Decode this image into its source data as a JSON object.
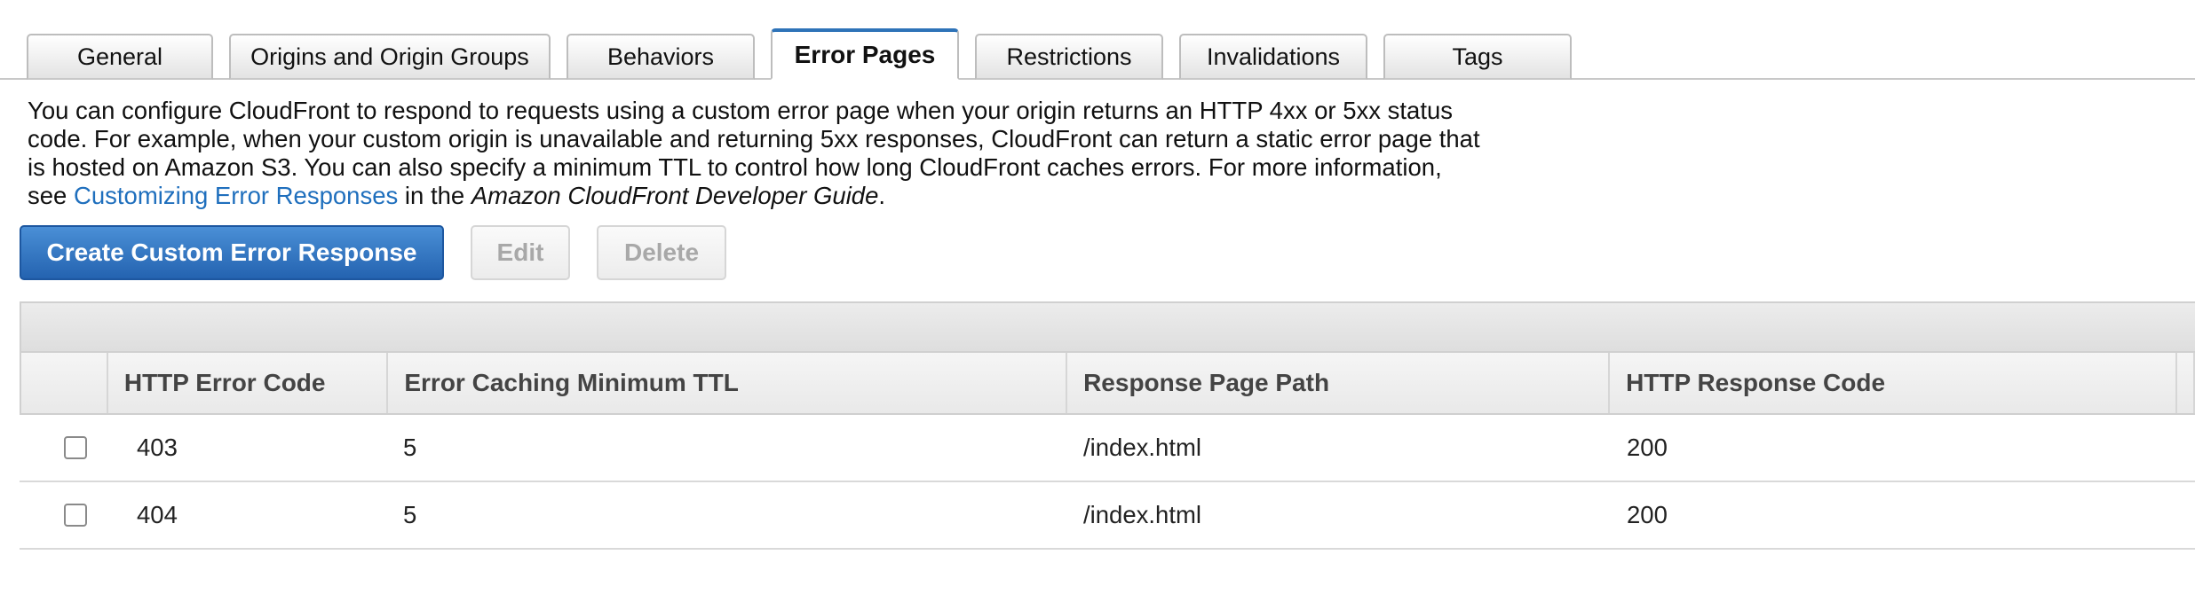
{
  "tabs": [
    {
      "label": "General",
      "active": false
    },
    {
      "label": "Origins and Origin Groups",
      "active": false
    },
    {
      "label": "Behaviors",
      "active": false
    },
    {
      "label": "Error Pages",
      "active": true
    },
    {
      "label": "Restrictions",
      "active": false
    },
    {
      "label": "Invalidations",
      "active": false
    },
    {
      "label": "Tags",
      "active": false
    }
  ],
  "description": {
    "text": "You can configure CloudFront to respond to requests using a custom error page when your origin returns an HTTP 4xx or 5xx status code. For example, when your custom origin is unavailable and returning 5xx responses, CloudFront can return a static error page that is hosted on Amazon S3. You can also specify a minimum TTL to control how long CloudFront caches errors. For more information, see ",
    "link_text": "Customizing Error Responses",
    "middle_text": " in the ",
    "guide_text": "Amazon CloudFront Developer Guide",
    "end_text": "."
  },
  "toolbar": {
    "create_label": "Create Custom Error Response",
    "edit_label": "Edit",
    "delete_label": "Delete"
  },
  "table": {
    "columns": [
      "HTTP Error Code",
      "Error Caching Minimum TTL",
      "Response Page Path",
      "HTTP Response Code"
    ],
    "rows": [
      {
        "error_code": "403",
        "ttl": "5",
        "path": "/index.html",
        "response_code": "200"
      },
      {
        "error_code": "404",
        "ttl": "5",
        "path": "/index.html",
        "response_code": "200"
      }
    ]
  },
  "colors": {
    "accent": "#2e73b8",
    "link": "#1f6fbd",
    "primary_button": "#2463b0"
  }
}
